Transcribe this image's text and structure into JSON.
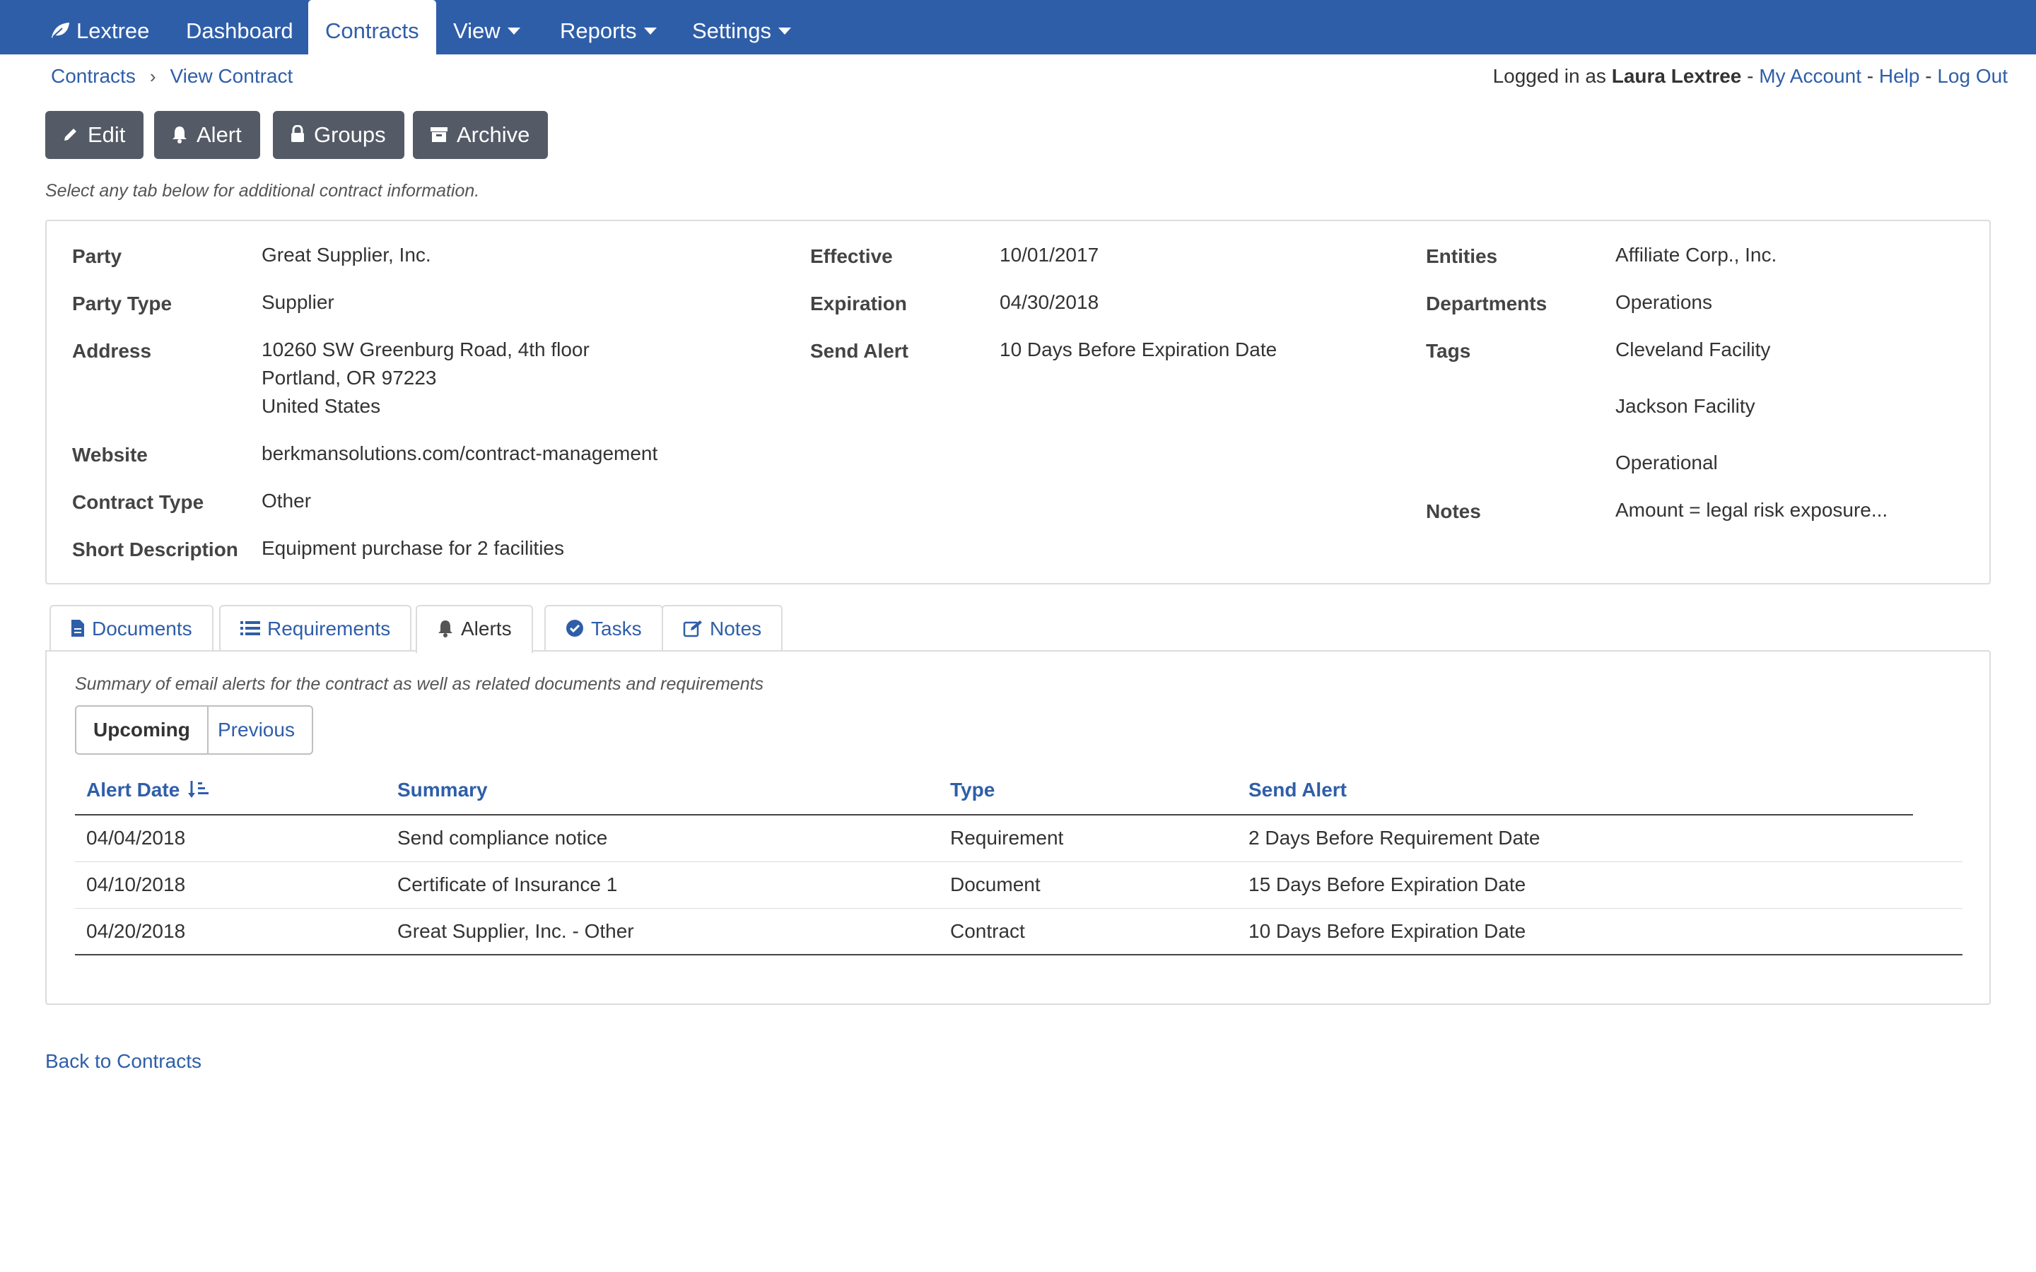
{
  "nav": {
    "brand": "Lextree",
    "items": [
      {
        "label": "Dashboard"
      },
      {
        "label": "Contracts"
      },
      {
        "label": "View"
      },
      {
        "label": "Reports"
      },
      {
        "label": "Settings"
      }
    ]
  },
  "breadcrumb": {
    "items": [
      "Contracts",
      "View Contract"
    ],
    "separator": "›"
  },
  "userbar": {
    "prefix": "Logged in as",
    "user": "Laura Lextree",
    "my_account": "My Account",
    "help": "Help",
    "logout": "Log Out",
    "dash": "-"
  },
  "actions": {
    "edit": "Edit",
    "alert": "Alert",
    "groups": "Groups",
    "archive": "Archive"
  },
  "hint": "Select any tab below for additional contract information.",
  "details": {
    "party_label": "Party",
    "party_value": "Great Supplier, Inc.",
    "party_type_label": "Party Type",
    "party_type_value": "Supplier",
    "address_label": "Address",
    "address_line1": "10260 SW Greenburg Road, 4th floor",
    "address_line2": "Portland, OR 97223",
    "address_line3": "United States",
    "website_label": "Website",
    "website_value": "berkmansolutions.com/contract-management",
    "contract_type_label": "Contract Type",
    "contract_type_value": "Other",
    "short_desc_label": "Short Description",
    "short_desc_value": "Equipment purchase for 2 facilities",
    "effective_label": "Effective",
    "effective_value": "10/01/2017",
    "expiration_label": "Expiration",
    "expiration_value": "04/30/2018",
    "send_alert_label": "Send Alert",
    "send_alert_value": "10 Days Before Expiration Date",
    "entities_label": "Entities",
    "entities_value": "Affiliate Corp., Inc.",
    "departments_label": "Departments",
    "departments_value": "Operations",
    "tags_label": "Tags",
    "tags": [
      "Cleveland Facility",
      "Jackson Facility",
      "Operational"
    ],
    "notes_label": "Notes",
    "notes_value": "Amount = legal risk exposure..."
  },
  "tabs": [
    {
      "label": "Documents",
      "icon": "file-icon"
    },
    {
      "label": "Requirements",
      "icon": "list-icon"
    },
    {
      "label": "Alerts",
      "icon": "bell-icon",
      "active": true
    },
    {
      "label": "Tasks",
      "icon": "check-circle-icon"
    },
    {
      "label": "Notes",
      "icon": "edit-icon"
    }
  ],
  "alerts_panel": {
    "summary": "Summary of email alerts for the contract as well as related documents and requirements",
    "toggle_upcoming": "Upcoming",
    "toggle_previous": "Previous",
    "selected": "Upcoming",
    "columns": [
      "Alert Date",
      "Summary",
      "Type",
      "Send Alert"
    ],
    "rows": [
      {
        "date": "04/04/2018",
        "summary": "Send compliance notice",
        "type": "Requirement",
        "send_alert": "2 Days Before Requirement Date"
      },
      {
        "date": "04/10/2018",
        "summary": "Certificate of Insurance 1",
        "type": "Document",
        "send_alert": "15 Days Before Expiration Date"
      },
      {
        "date": "04/20/2018",
        "summary": "Great Supplier, Inc. - Other",
        "type": "Contract",
        "send_alert": "10 Days Before Expiration Date"
      }
    ]
  },
  "back_link": "Back to Contracts",
  "colors": {
    "primary": "#2f5ea9",
    "button": "#545b66",
    "border": "#dcdcdc"
  }
}
